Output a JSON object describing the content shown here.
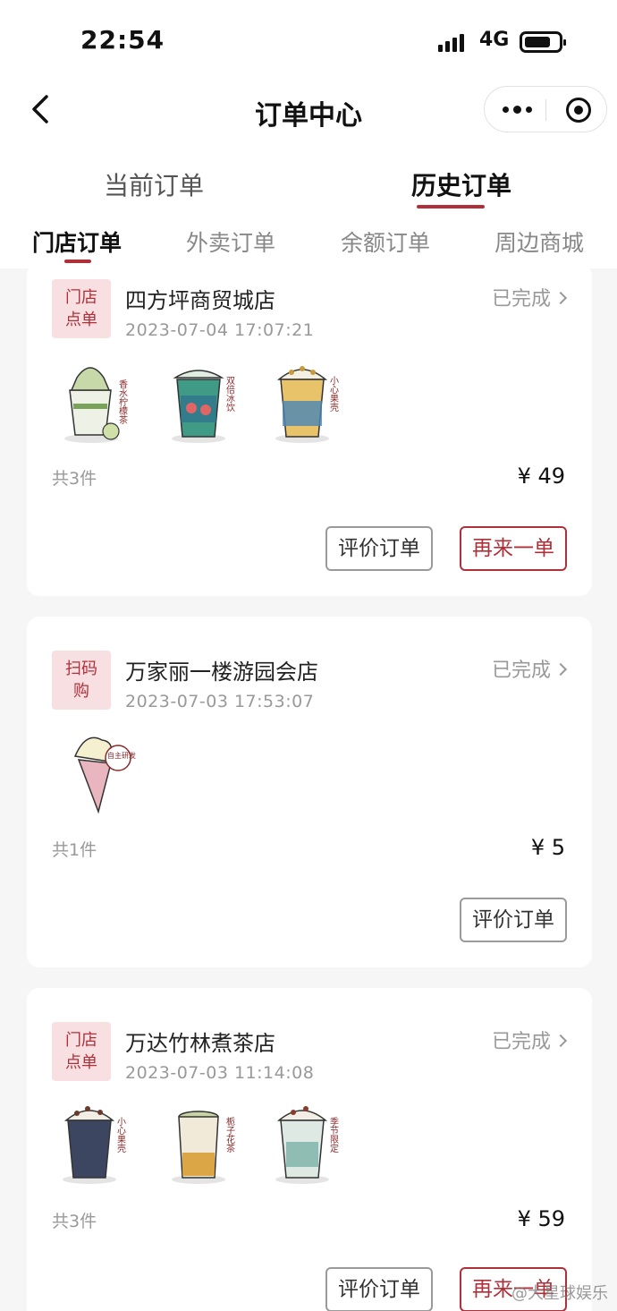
{
  "status_bar": {
    "time": "22:54",
    "network": "4G"
  },
  "nav": {
    "title": "订单中心",
    "more_icon": "more-dots-icon",
    "close_icon": "target-icon"
  },
  "main_tabs": [
    {
      "label": "当前订单",
      "active": false
    },
    {
      "label": "历史订单",
      "active": true
    }
  ],
  "sub_tabs": [
    {
      "label": "门店订单",
      "active": true
    },
    {
      "label": "外卖订单",
      "active": false
    },
    {
      "label": "余额订单",
      "active": false
    },
    {
      "label": "周边商城",
      "active": false
    }
  ],
  "orders": [
    {
      "badge": [
        "门店",
        "点单"
      ],
      "store": "四方坪商贸城店",
      "time": "2023-07-04 17:07:21",
      "status": "已完成",
      "count": "共3件",
      "price": "¥ 49",
      "item_labels": [
        "香水柠檬茶",
        "双倍冰饮",
        "小心果壳"
      ],
      "buttons": [
        "评价订单",
        "再来一单"
      ]
    },
    {
      "badge": [
        "扫码",
        "购"
      ],
      "store": "万家丽一楼游园会店",
      "time": "2023-07-03 17:53:07",
      "status": "已完成",
      "count": "共1件",
      "price": "¥ 5",
      "item_labels": [
        "自主研发"
      ],
      "buttons": [
        "评价订单"
      ]
    },
    {
      "badge": [
        "门店",
        "点单"
      ],
      "store": "万达竹林煮茶店",
      "time": "2023-07-03 11:14:08",
      "status": "已完成",
      "count": "共3件",
      "price": "¥ 59",
      "item_labels": [
        "小心果壳",
        "栀子花茶",
        "季节限定"
      ],
      "buttons": [
        "评价订单",
        "再来一单"
      ]
    }
  ],
  "watermark": "@大星球娱乐",
  "colors": {
    "accent": "#b0303a",
    "badge_bg": "#f8e0e2",
    "muted": "#999999"
  }
}
